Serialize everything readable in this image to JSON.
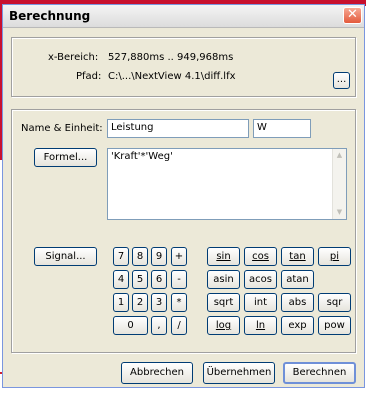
{
  "window": {
    "title": "Berechnung",
    "close_glyph": "✕"
  },
  "info": {
    "range_label": "x-Bereich:",
    "range_value": "527,880ms .. 949,968ms",
    "path_label": "Pfad:",
    "path_value": "C:\\...\\NextView 4.1\\diff.lfx",
    "browse_label": "..."
  },
  "form": {
    "name_label": "Name & Einheit:",
    "name_value": "Leistung",
    "unit_value": "W",
    "formula_button": "Formel...",
    "formula_value": "'Kraft'*'Weg'",
    "signal_button": "Signal..."
  },
  "keypad": {
    "digits": [
      "7",
      "8",
      "9",
      "+",
      "4",
      "5",
      "6",
      "-",
      "1",
      "2",
      "3",
      "*",
      "0",
      ",",
      "/"
    ],
    "functions": [
      "sin",
      "cos",
      "tan",
      "pi",
      "asin",
      "acos",
      "atan",
      "sqrt",
      "int",
      "abs",
      "sqr",
      "log",
      "ln",
      "exp",
      "pow"
    ]
  },
  "footer": {
    "cancel": "Abbrechen",
    "apply": "Übernehmen",
    "compute": "Berechnen"
  }
}
